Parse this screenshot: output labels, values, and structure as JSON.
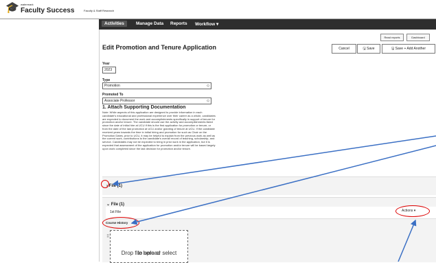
{
  "brand": {
    "small": "watermark",
    "title": "Faculty Success",
    "subtitle": "Faculty & Staff Research"
  },
  "nav": {
    "activities": "Activities",
    "manage_data": "Manage Data",
    "reports": "Reports",
    "workflow": "Workflow"
  },
  "top_buttons": {
    "read_reports": "Read reports",
    "dashboard": "Dashboard"
  },
  "page_title": "Edit Promotion and Tenure Application",
  "actions": {
    "cancel": "Cancel",
    "save": "Save",
    "save_add": "Save + Add Another"
  },
  "fields": {
    "year": {
      "label": "Year",
      "value": "2023"
    },
    "type": {
      "label": "Type",
      "value": "Promotion"
    },
    "promoted_to": {
      "label": "Promoted To",
      "value": "Associate Professor"
    }
  },
  "section_title": "1. Attach Supporting Documentation",
  "note": "Note: While aspects of this application are designed to provide information in each candidate's educational and professional experience over their career as a whole, candidates are expected to document the work and accomplishments specifically in support of tenure for promotion and/or tenure. The candidate should use the activity and accomplishments listed since the date of initial hire at UCU if this is the first application for promotion or tenure, or from the date of the last promotion at UCU and/or granting of tenure at UCU. If the candidate received years towards the time in initial hiring and promotion for such as Chair on the Promotion Dates, prior to UCU, it may be helpful to explain from the previous work as well as the current work, contributions to the candidate's overall record of teaching, scholarship, and service. Candidates may not be expected to bring in prior work in the application, but it is expected that assessment of the application for promotion and/or tenure will be based largely upon work completed since the last decision for promotion and/or tenure.",
  "file_panel_collapsed": {
    "title": "File (1)"
  },
  "file_panel_expanded": {
    "title": "File (1)",
    "row_label": "1st File",
    "actions_label": "Actions",
    "field_label": "Course History",
    "drop_text_line1": "Drop file here or select",
    "drop_text_line2": "to upload"
  },
  "icons": {
    "brand": "graduation-cap-icon",
    "collapsed_chevron": "chevron-right-icon",
    "expanded_chevron": "chevron-down-icon",
    "drag": "drag-handle-icon",
    "save": "save-icon"
  },
  "annotation_color": "#3a6fc4",
  "highlight_color": "#dd0000"
}
